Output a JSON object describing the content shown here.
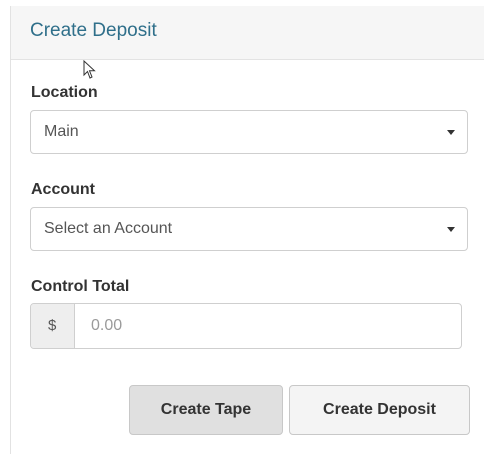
{
  "panel": {
    "title": "Create Deposit"
  },
  "form": {
    "location": {
      "label": "Location",
      "value": "Main"
    },
    "account": {
      "label": "Account",
      "placeholder": "Select an Account"
    },
    "control_total": {
      "label": "Control Total",
      "currency_symbol": "$",
      "placeholder": "0.00"
    }
  },
  "actions": {
    "create_tape_label": "Create Tape",
    "create_deposit_label": "Create Deposit"
  },
  "icons": {
    "cursor": "mouse-pointer-icon",
    "dropdown": "caret-down-icon"
  },
  "colors": {
    "title": "#2f6f8a",
    "header_bg": "#f6f6f6",
    "button_tape_bg": "#e0e0e0",
    "button_deposit_bg": "#f4f4f4"
  }
}
